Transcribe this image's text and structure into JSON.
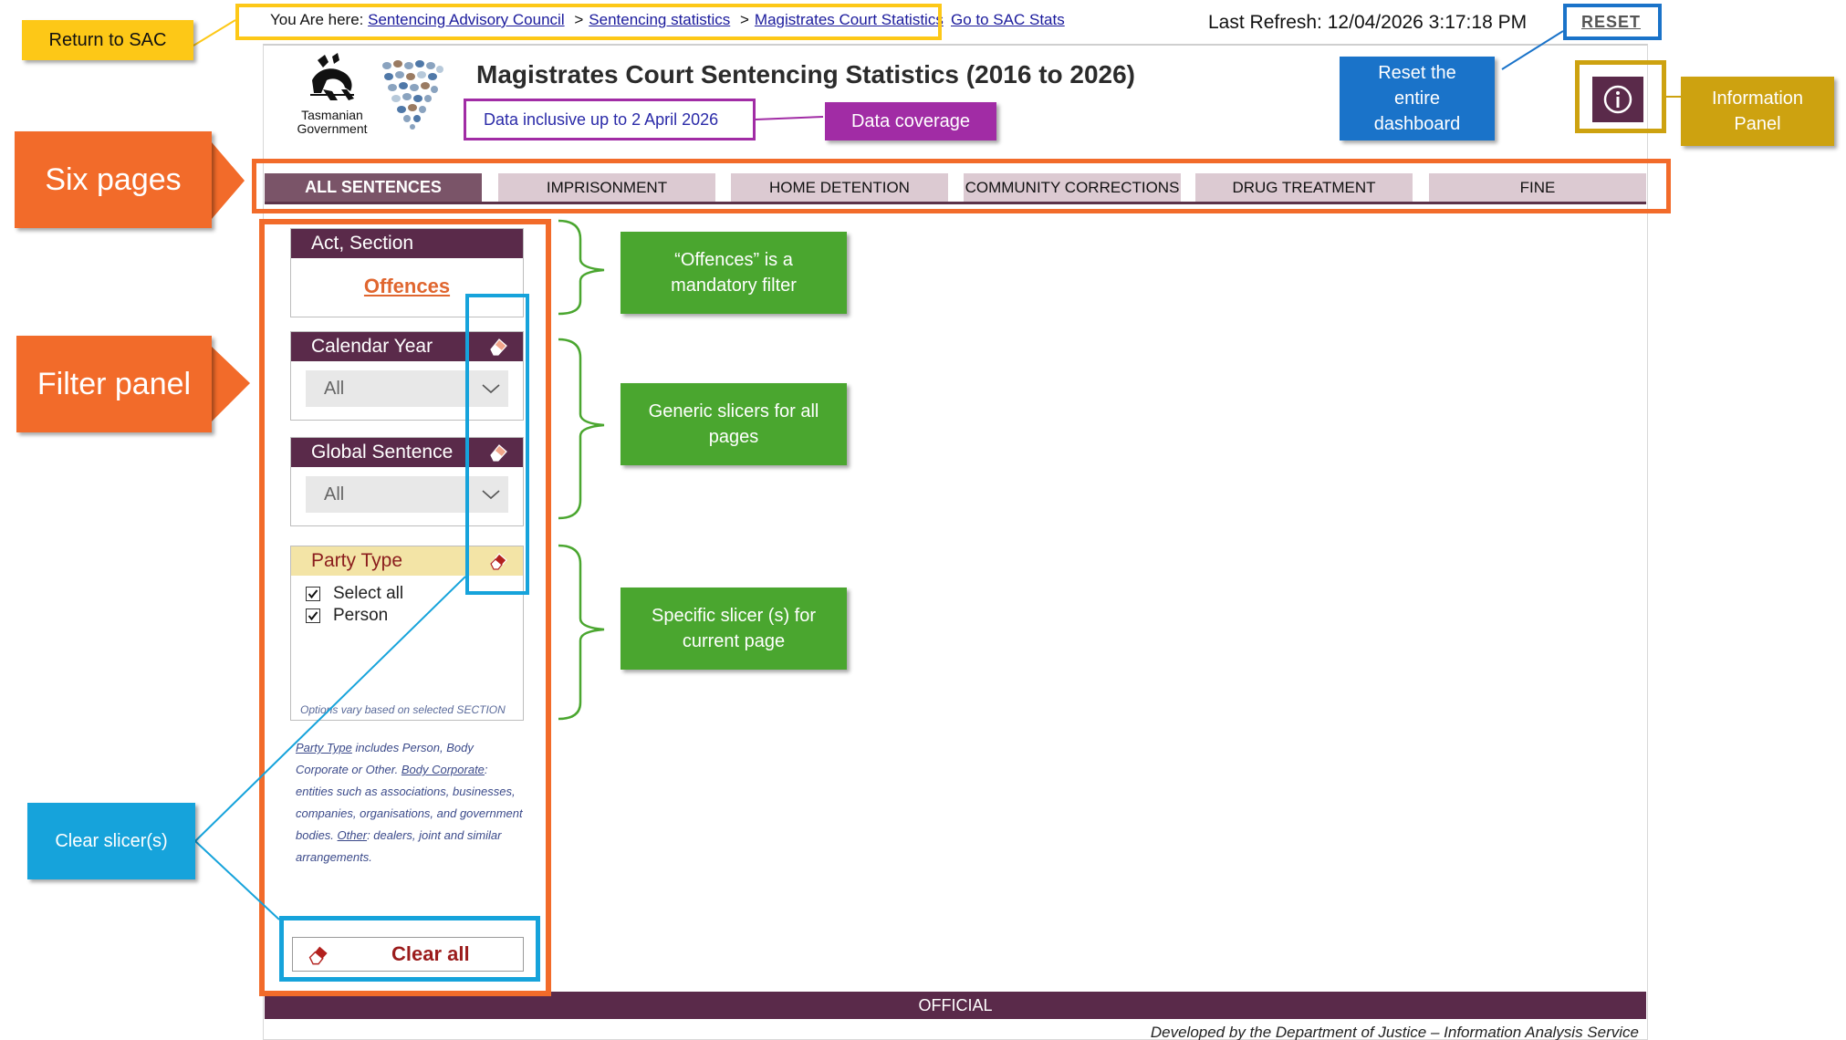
{
  "breadcrumb": {
    "prefix": "You Are here:",
    "items": [
      "Sentencing Advisory Council",
      "Sentencing statistics",
      "Magistrates Court Statistics"
    ],
    "separators": [
      ">",
      ">"
    ],
    "goto_link": "Go to SAC Stats"
  },
  "header": {
    "last_refresh_label": "Last Refresh:",
    "last_refresh_value": "12/04/2026 3:17:18 PM",
    "reset_label": "RESET",
    "title": "Magistrates Court Sentencing Statistics",
    "title_range": "(2016 to 2026)",
    "coverage": "Data inclusive up to 2 April 2026",
    "logo_text_line1": "Tasmanian",
    "logo_text_line2": "Government"
  },
  "tabs": [
    {
      "label": "ALL SENTENCES",
      "active": true
    },
    {
      "label": "IMPRISONMENT",
      "active": false
    },
    {
      "label": "HOME DETENTION",
      "active": false
    },
    {
      "label": "COMMUNITY CORRECTIONS",
      "active": false
    },
    {
      "label": "DRUG TREATMENT",
      "active": false
    },
    {
      "label": "FINE",
      "active": false
    }
  ],
  "filters": {
    "act_section": {
      "header": "Act, Section",
      "link": "Offences"
    },
    "calendar_year": {
      "header": "Calendar Year",
      "value": "All"
    },
    "global_sentence": {
      "header": "Global Sentence",
      "value": "All"
    },
    "party_type": {
      "header": "Party Type",
      "options": [
        {
          "label": "Select all",
          "checked": true
        },
        {
          "label": "Person",
          "checked": true
        }
      ],
      "note": "Options vary based on selected SECTION"
    },
    "explanation": {
      "t1": "Party Type",
      "t2": " includes Person, Body Corporate or Other. ",
      "t3": "Body Corporate",
      "t4": ": entities such as associations, businesses, companies, organisations, and government bodies. ",
      "t5": "Other",
      "t6": ": dealers, joint and similar arrangements."
    },
    "clear_all_label": "Clear all"
  },
  "footer": {
    "classification": "OFFICIAL",
    "developed_by": "Developed by the Department of Justice – Information Analysis Service"
  },
  "annotations": {
    "return_to_sac": "Return to SAC",
    "six_pages": "Six pages",
    "filter_panel": "Filter panel",
    "clear_slicers": "Clear slicer(s)",
    "data_coverage": "Data coverage",
    "reset_dashboard_l1": "Reset the",
    "reset_dashboard_l2": "entire",
    "reset_dashboard_l3": "dashboard",
    "information_panel_l1": "Information",
    "information_panel_l2": "Panel",
    "offences_mandatory_l1": "“Offences” is a",
    "offences_mandatory_l2": "mandatory filter",
    "generic_slicers_l1": "Generic slicers for all",
    "generic_slicers_l2": "pages",
    "specific_slicers_l1": "Specific slicer (s) for",
    "specific_slicers_l2": "current page"
  },
  "colors": {
    "brand_plum": "#5a2a4a",
    "tab_inactive": "#dccad2",
    "tab_active": "#7a5468",
    "link_orange": "#e0662f",
    "annotation_yellow": "#fdc817",
    "annotation_orange": "#f26b2a",
    "annotation_green": "#4aa62f",
    "annotation_blue": "#1a73c9",
    "annotation_cyan": "#16a3db",
    "annotation_purple": "#a12ca5",
    "annotation_gold": "#cda210"
  }
}
